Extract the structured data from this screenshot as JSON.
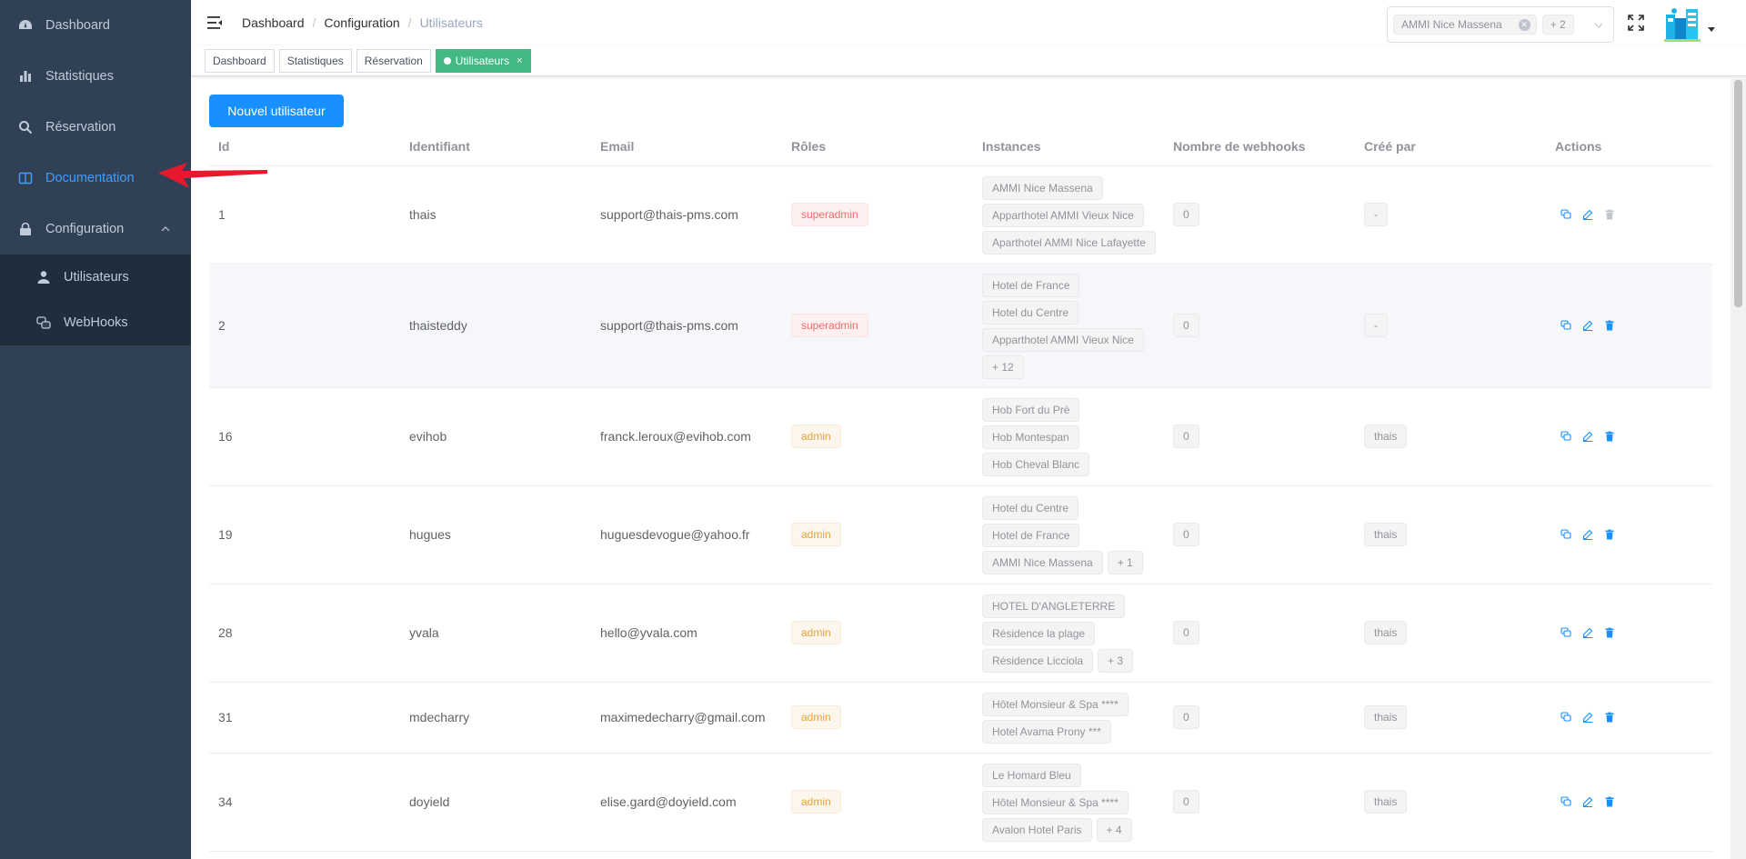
{
  "sidebar": {
    "items": [
      {
        "label": "Dashboard"
      },
      {
        "label": "Statistiques"
      },
      {
        "label": "Réservation"
      },
      {
        "label": "Documentation"
      },
      {
        "label": "Configuration"
      }
    ],
    "submenu": [
      {
        "label": "Utilisateurs"
      },
      {
        "label": "WebHooks"
      }
    ]
  },
  "navbar": {
    "breadcrumb": [
      "Dashboard",
      "Configuration",
      "Utilisateurs"
    ],
    "hotel_select": {
      "selected": "AMMI Nice Massena",
      "more": "+ 2"
    }
  },
  "tagsview": {
    "tags": [
      "Dashboard",
      "Statistiques",
      "Réservation",
      "Utilisateurs"
    ],
    "close": "×"
  },
  "main": {
    "new_user_label": "Nouvel utilisateur",
    "columns": [
      "Id",
      "Identifiant",
      "Email",
      "Rôles",
      "Instances",
      "Nombre de webhooks",
      "Créé par",
      "Actions"
    ],
    "rows": [
      {
        "id": "1",
        "login": "thais",
        "email": "support@thais-pms.com",
        "role": "superadmin",
        "instances": [
          [
            "AMMI Nice Massena"
          ],
          [
            "Apparthotel AMMI Vieux Nice"
          ],
          [
            "Aparthotel AMMI Nice Lafayette"
          ]
        ],
        "webhooks": "0",
        "created_by": "-"
      },
      {
        "id": "2",
        "login": "thaisteddy",
        "email": "support@thais-pms.com",
        "role": "superadmin",
        "instances": [
          [
            "Hotel de France"
          ],
          [
            "Hotel du Centre"
          ],
          [
            "Apparthotel AMMI Vieux Nice"
          ],
          [
            "+ 12"
          ]
        ],
        "webhooks": "0",
        "created_by": "-"
      },
      {
        "id": "16",
        "login": "evihob",
        "email": "franck.leroux@evihob.com",
        "role": "admin",
        "instances": [
          [
            "Hob Fort du Prè"
          ],
          [
            "Hob Montespan"
          ],
          [
            "Hob Cheval Blanc"
          ]
        ],
        "webhooks": "0",
        "created_by": "thais"
      },
      {
        "id": "19",
        "login": "hugues",
        "email": "huguesdevogue@yahoo.fr",
        "role": "admin",
        "instances": [
          [
            "Hotel du Centre"
          ],
          [
            "Hotel de France"
          ],
          [
            "AMMI Nice Massena",
            "+ 1"
          ]
        ],
        "webhooks": "0",
        "created_by": "thais"
      },
      {
        "id": "28",
        "login": "yvala",
        "email": "hello@yvala.com",
        "role": "admin",
        "instances": [
          [
            "HOTEL D'ANGLETERRE"
          ],
          [
            "Résidence la plage"
          ],
          [
            "Résidence Licciola",
            "+ 3"
          ]
        ],
        "webhooks": "0",
        "created_by": "thais"
      },
      {
        "id": "31",
        "login": "mdecharry",
        "email": "maximedecharry@gmail.com",
        "role": "admin",
        "instances": [
          [
            "Hôtel Monsieur & Spa ****"
          ],
          [
            "Hotel Avama Prony ***"
          ]
        ],
        "webhooks": "0",
        "created_by": "thais"
      },
      {
        "id": "34",
        "login": "doyield",
        "email": "elise.gard@doyield.com",
        "role": "admin",
        "instances": [
          [
            "Le Homard Bleu"
          ],
          [
            "Hôtel Monsieur & Spa ****"
          ],
          [
            "Avalon Hotel Paris",
            "+ 4"
          ]
        ],
        "webhooks": "0",
        "created_by": "thais"
      }
    ]
  },
  "colors": {
    "sidebar_bg": "#304156",
    "sidebar_active": "#409eff",
    "primary": "#1890ff",
    "tag_active": "#42b983",
    "danger": "#f56c6c",
    "warning": "#e6a23c",
    "arrow": "#e8192c"
  }
}
